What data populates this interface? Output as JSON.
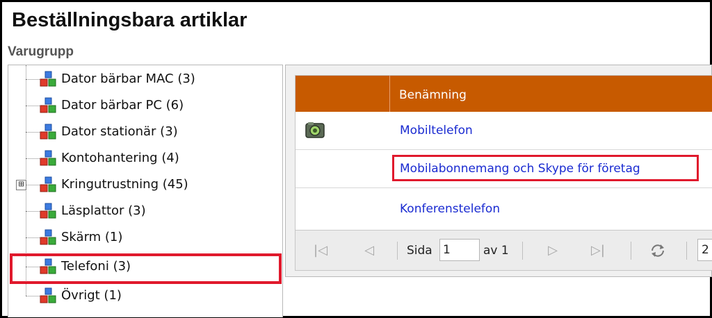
{
  "page": {
    "title": "Beställningsbara artiklar",
    "section_label": "Varugrupp"
  },
  "tree": {
    "items": [
      {
        "label": "Dator bärbar MAC (3)",
        "expandable": false
      },
      {
        "label": "Dator bärbar PC (6)",
        "expandable": false
      },
      {
        "label": "Dator stationär (3)",
        "expandable": false
      },
      {
        "label": "Kontohantering (4)",
        "expandable": false
      },
      {
        "label": "Kringutrustning (45)",
        "expandable": true,
        "expander": "⊞"
      },
      {
        "label": "Läsplattor (3)",
        "expandable": false
      },
      {
        "label": "Skärm (1)",
        "expandable": false
      },
      {
        "label": "Telefoni (3)",
        "expandable": false,
        "selected": true
      },
      {
        "label": "Övrigt (1)",
        "expandable": false
      }
    ]
  },
  "grid": {
    "column_header": "Benämning",
    "header_color": "#c75a00",
    "rows": [
      {
        "name": "Mobiltelefon",
        "has_image": true
      },
      {
        "name": "Mobilabonnemang och Skype för företag",
        "has_image": false,
        "highlighted": true
      },
      {
        "name": "Konferenstelefon",
        "has_image": false
      }
    ]
  },
  "pager": {
    "page_label": "Sida",
    "page_value": "1",
    "of_label": "av 1",
    "page_size_value": "2"
  },
  "colors": {
    "highlight": "#e0192c",
    "link": "#1a2bd1"
  }
}
